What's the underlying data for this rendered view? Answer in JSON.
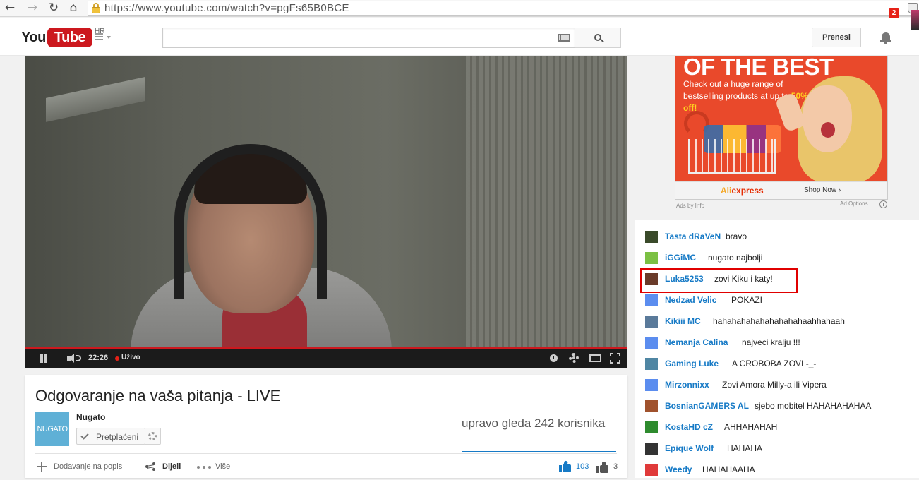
{
  "browser": {
    "url": "https://www.youtube.com/watch?v=pgFs65B0BCE",
    "nav_icons": [
      "back-arrow-icon",
      "forward-arrow-icon",
      "reload-icon",
      "home-icon",
      "lock-icon",
      "shield-icon"
    ],
    "glyphs": {
      "back": "←",
      "forward": "→",
      "reload": "↻",
      "home": "⌂"
    }
  },
  "masthead": {
    "logo_you": "You",
    "logo_tube": "Tube",
    "region": "HR",
    "search_placeholder": "",
    "upload_label": "Prenesi",
    "notification_count": "2"
  },
  "player": {
    "time": "22:26",
    "live_label": "Uživo",
    "progress": 1.0,
    "icons": [
      "pause-icon",
      "volume-icon",
      "info-icon",
      "gear-icon",
      "theater-icon",
      "fullscreen-icon"
    ]
  },
  "video": {
    "title": "Odgovaranje na vaša pitanja - LIVE",
    "channel": "Nugato",
    "channel_thumb_text": "NUGATO",
    "subscribe_label": "Pretplaćeni",
    "viewers": "upravo gleda 242 korisnika",
    "actions": {
      "add_to": "Dodavanje na popis",
      "share": "Dijeli",
      "more": "Više"
    },
    "likes": "103",
    "dislikes": "3"
  },
  "ad": {
    "headline": "OF THE BEST",
    "body_start": "Check out a huge range of bestselling products at up to ",
    "body_highlight": "50% off!",
    "brand_a": "Ali",
    "brand_b": "express",
    "shop_now": "Shop Now ›",
    "byline": "Ads by Info",
    "options": "Ad Options"
  },
  "chat": {
    "messages": [
      {
        "author": "Tasta dRaVeN",
        "text": "bravo",
        "avatar_color": "#3a4a2a"
      },
      {
        "author": "iGGiMC",
        "text": "nugato najbolji",
        "avatar_color": "#7bc043"
      },
      {
        "author": "Luka5253",
        "text": "zovi Kiku i katy!",
        "avatar_color": "#6a3b2a"
      },
      {
        "author": "Nedzad Velic",
        "text": "POKAZI",
        "avatar_color": "#5b8def"
      },
      {
        "author": "Kikiii MC",
        "text": "hahahahahahahahahahaahhahaah",
        "avatar_color": "#5a7a9a"
      },
      {
        "author": "Nemanja Calina",
        "text": "najveci kralju !!!",
        "avatar_color": "#5b8def"
      },
      {
        "author": "Gaming Luke",
        "text": "A CROBOBA ZOVI -_-",
        "avatar_color": "#4f86a3"
      },
      {
        "author": "Mirzonnixx",
        "text": "Zovi Amora Milly-a ili Vipera",
        "avatar_color": "#5b8def"
      },
      {
        "author": "BosnianGAMERS AL",
        "text": "sjebo mobitel HAHAHAHAHAA",
        "avatar_color": "#a0522d"
      },
      {
        "author": "KostaHD cZ",
        "text": "AHHAHAHAH",
        "avatar_color": "#2e8b2e"
      },
      {
        "author": "Epique Wolf",
        "text": "HAHAHA",
        "avatar_color": "#333333"
      },
      {
        "author": "Weedy",
        "text": "HAHAHAAHA",
        "avatar_color": "#e03a3a"
      }
    ],
    "highlighted_index": 2
  },
  "colors": {
    "brand_red": "#cc181e",
    "link_blue": "#167ac6",
    "highlight_red": "#e00000",
    "ad_orange": "#e9492b"
  }
}
